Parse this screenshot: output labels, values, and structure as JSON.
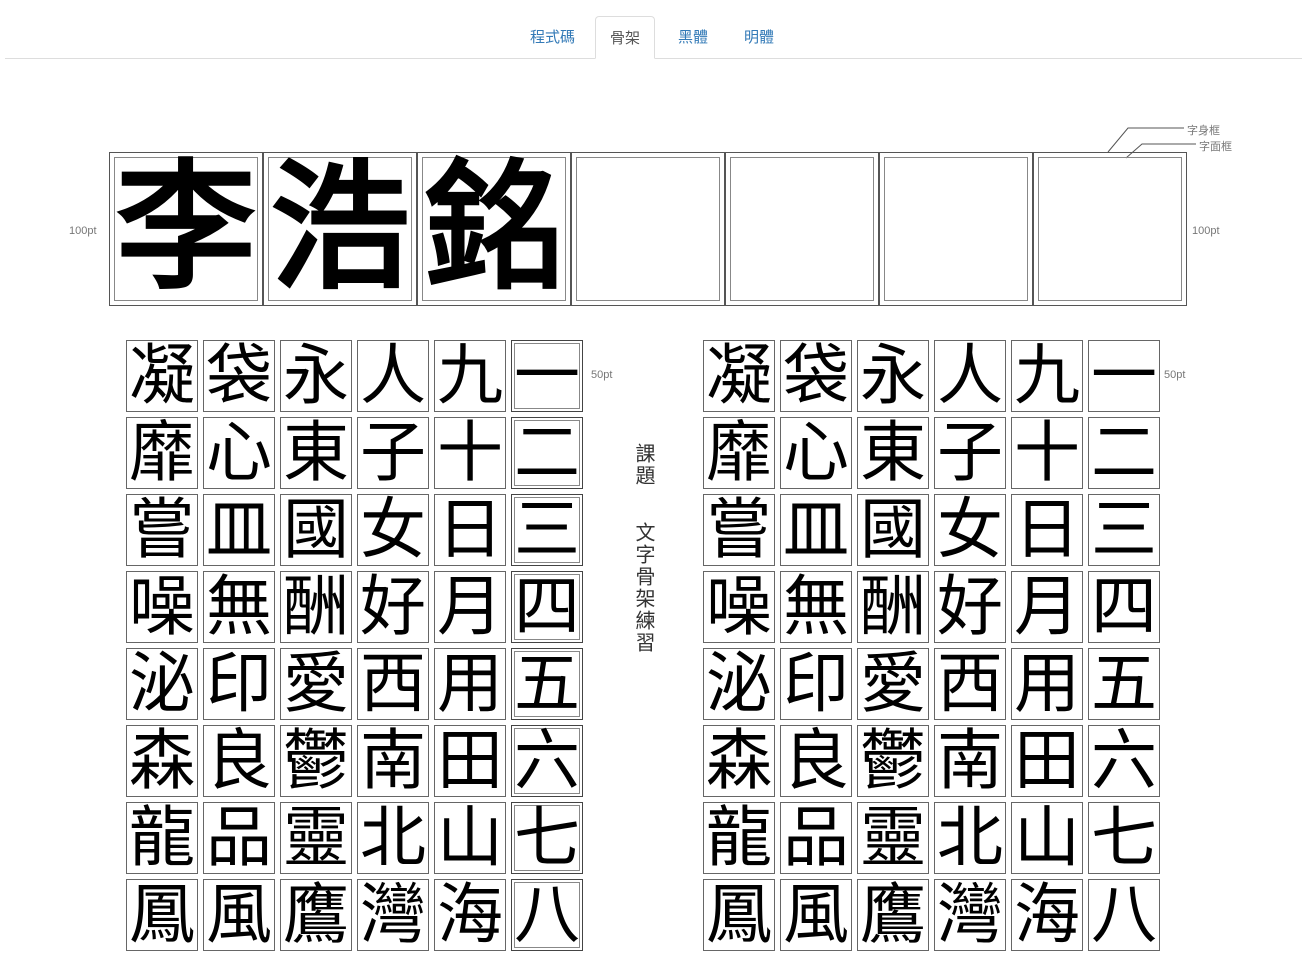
{
  "tabs": [
    {
      "label": "程式碼",
      "active": false
    },
    {
      "label": "骨架",
      "active": true
    },
    {
      "label": "黑體",
      "active": false
    },
    {
      "label": "明體",
      "active": false
    }
  ],
  "legend": {
    "outer": "字身框",
    "inner": "字面框"
  },
  "banner": {
    "size_label_left": "100pt",
    "size_label_right": "100pt",
    "chars": [
      "李",
      "浩",
      "銘",
      "",
      "",
      "",
      ""
    ]
  },
  "practice": {
    "size_label": "50pt",
    "title_line1": "課題",
    "title_line2": "文字骨架練習",
    "columns": [
      [
        "凝",
        "靡",
        "嘗",
        "噪",
        "泌",
        "森",
        "龍",
        "鳳"
      ],
      [
        "袋",
        "心",
        "皿",
        "無",
        "印",
        "良",
        "品",
        "風"
      ],
      [
        "永",
        "東",
        "國",
        "酬",
        "愛",
        "鬱",
        "靈",
        "鷹"
      ],
      [
        "人",
        "子",
        "女",
        "好",
        "西",
        "南",
        "北",
        "灣"
      ],
      [
        "九",
        "十",
        "日",
        "月",
        "用",
        "田",
        "山",
        "海"
      ],
      [
        "一",
        "二",
        "三",
        "四",
        "五",
        "六",
        "七",
        "八"
      ]
    ]
  },
  "colors": {
    "tab_link": "#337ab7",
    "frame": "#555555"
  }
}
